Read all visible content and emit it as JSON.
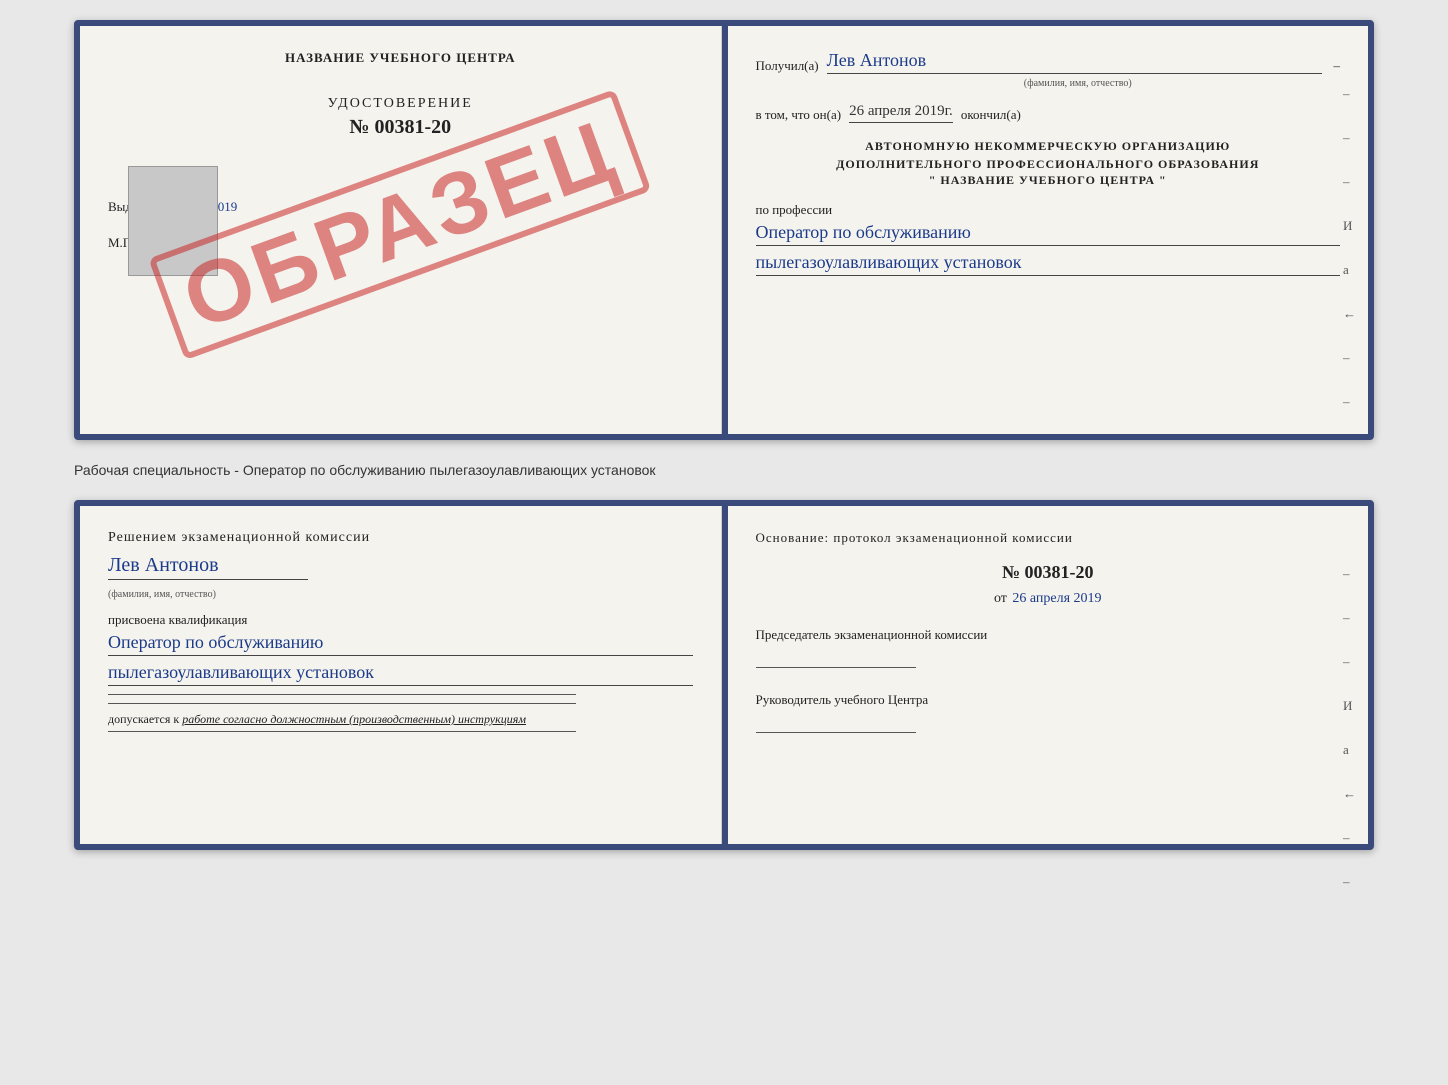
{
  "top": {
    "left": {
      "school_name": "НАЗВАНИЕ УЧЕБНОГО ЦЕНТРА",
      "cert_label": "УДОСТОВЕРЕНИЕ",
      "cert_number": "№ 00381-20",
      "issued_prefix": "Выдано",
      "issued_date": "26 апреля 2019",
      "mp": "М.П.",
      "stamp_text": "ОБРАЗЕЦ"
    },
    "right": {
      "received_prefix": "Получил(а)",
      "recipient_name": "Лев Антонов",
      "recipient_sublabel": "(фамилия, имя, отчество)",
      "date_prefix": "в том, что он(а)",
      "date_value": "26 апреля 2019г.",
      "date_suffix": "окончил(а)",
      "org_line1": "АВТОНОМНУЮ НЕКОММЕРЧЕСКУЮ ОРГАНИЗАЦИЮ",
      "org_line2": "ДОПОЛНИТЕЛЬНОГО ПРОФЕССИОНАЛЬНОГО ОБРАЗОВАНИЯ",
      "org_name": "\"  НАЗВАНИЕ УЧЕБНОГО ЦЕНТРА  \"",
      "profession_label": "по профессии",
      "profession_line1": "Оператор по обслуживанию",
      "profession_line2": "пылегазоулавливающих установок",
      "dashes": [
        "–",
        "–",
        "–",
        "И",
        "а",
        "←",
        "–",
        "–",
        "–",
        "–"
      ]
    }
  },
  "separator": {
    "text": "Рабочая специальность - Оператор по обслуживанию пылегазоулавливающих установок"
  },
  "bottom": {
    "left": {
      "commission_title": "Решением экзаменационной комиссии",
      "name_sublabel": "(фамилия, имя, отчество)",
      "recipient_name": "Лев Антонов",
      "assigned_label": "присвоена квалификация",
      "qualification_line1": "Оператор по обслуживанию",
      "qualification_line2": "пылегазоулавливающих установок",
      "допуск_prefix": "допускается к",
      "допуск_value": "работе согласно должностным (производственным) инструкциям"
    },
    "right": {
      "osnov_label": "Основание: протокол экзаменационной комиссии",
      "protocol_number": "№  00381-20",
      "protocol_date_prefix": "от",
      "protocol_date": "26 апреля 2019",
      "chairman_title": "Председатель экзаменационной комиссии",
      "center_head_title": "Руководитель учебного Центра",
      "dashes": [
        "–",
        "–",
        "–",
        "И",
        "а",
        "←",
        "–",
        "–"
      ]
    }
  }
}
